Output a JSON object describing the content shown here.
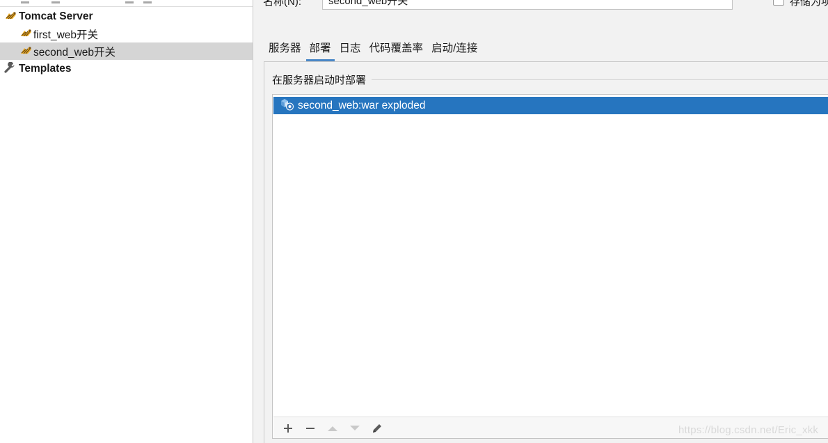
{
  "window": {
    "name_label": "名称(N):",
    "name_value": "second_web开关",
    "store_label": "存储为项"
  },
  "tree": {
    "items": [
      {
        "label": "Tomcat Server",
        "icon": "tomcat-icon",
        "bold": true
      },
      {
        "label": "first_web开关",
        "icon": "tomcat-icon"
      },
      {
        "label": "second_web开关",
        "icon": "tomcat-icon",
        "selected": true
      },
      {
        "label": "Templates",
        "icon": "wrench-icon",
        "bold": true
      }
    ]
  },
  "tabs": [
    {
      "label": "服务器"
    },
    {
      "label": "部署",
      "active": true
    },
    {
      "label": "日志"
    },
    {
      "label": "代码覆盖率"
    },
    {
      "label": "启动/连接"
    }
  ],
  "deploy": {
    "section_title": "在服务器启动时部署",
    "artifacts": [
      {
        "label": "second_web:war exploded",
        "icon": "artifact-icon",
        "selected": true
      }
    ],
    "toolbar": [
      {
        "name": "add-icon"
      },
      {
        "name": "remove-icon"
      },
      {
        "name": "move-up-icon"
      },
      {
        "name": "move-down-icon"
      },
      {
        "name": "edit-icon"
      }
    ]
  },
  "watermark": "https://blog.csdn.net/Eric_xkk",
  "colors": {
    "selection": "#2675bf",
    "tree_selected": "#d5d5d5",
    "tab_underline": "#4a88c7",
    "background": "#f2f2f2"
  }
}
